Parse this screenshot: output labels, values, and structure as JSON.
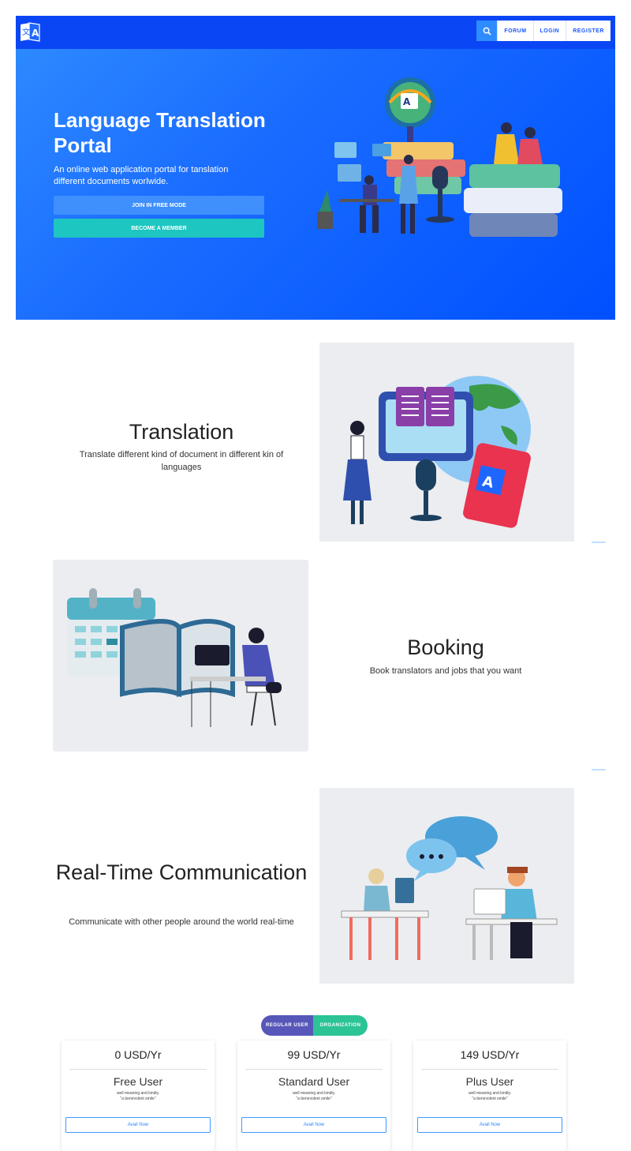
{
  "nav": {
    "items": [
      {
        "label": "FORUM"
      },
      {
        "label": "LOGIN"
      },
      {
        "label": "REGISTER"
      }
    ]
  },
  "hero": {
    "title": "Language Translation Portal",
    "subtitle": "An online web application portal for tanslation different documents worlwide.",
    "btn_free": "JOIN IN FREE MODE",
    "btn_member": "BECOME A MEMBER"
  },
  "features": {
    "translation": {
      "title": "Translation",
      "desc": "Translate different kind of document in different kin of languages"
    },
    "booking": {
      "title": "Booking",
      "desc": "Book translators and jobs that you want"
    },
    "realtime": {
      "title": "Real-Time Communication",
      "desc": "Communicate with other people around the world real-time"
    }
  },
  "pricing": {
    "toggle_regular": "REGULAR USER",
    "toggle_org": "ORGANIZATION",
    "plans": [
      {
        "price": "0 USD/Yr",
        "name": "Free User",
        "desc_line1": "well meaning and kindly.",
        "desc_line2": "\"a benevolent smile\"",
        "button": "Avail Now"
      },
      {
        "price": "99 USD/Yr",
        "name": "Standard User",
        "desc_line1": "well meaning and kindly.",
        "desc_line2": "\"a benevolent smile\"",
        "button": "Avail Now"
      },
      {
        "price": "149 USD/Yr",
        "name": "Plus User",
        "desc_line1": "well meaning and kindly.",
        "desc_line2": "\"a benevolent smile\"",
        "button": "Avail Now"
      }
    ]
  },
  "colors": {
    "primary": "#1a6cff",
    "navbar": "#0b46f5",
    "teal": "#1dc6c0",
    "toggle_regular": "#5757b9",
    "toggle_org": "#2cc497"
  },
  "icons": {
    "logo": "translate-logo-icon",
    "search": "search-icon"
  }
}
